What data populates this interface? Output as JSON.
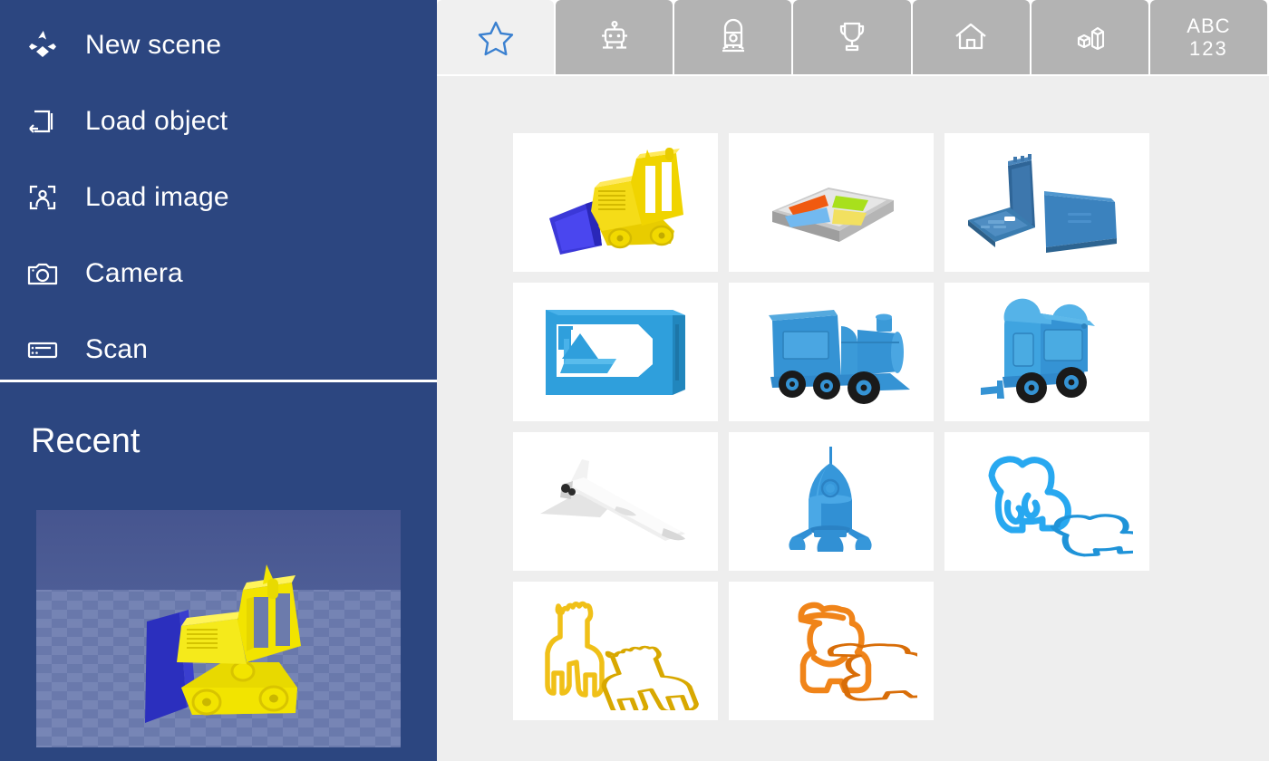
{
  "app": {
    "accent_blue": "#2c4680",
    "tab_inactive": "#b3b3b3",
    "tab_active": "#f0f0f0",
    "canvas_bg": "#eeeeee",
    "star_blue": "#3a80d0"
  },
  "sidebar": {
    "items": [
      {
        "label": "New scene",
        "icon": "new-scene-icon"
      },
      {
        "label": "Load object",
        "icon": "load-object-icon"
      },
      {
        "label": "Load image",
        "icon": "load-image-icon"
      },
      {
        "label": "Camera",
        "icon": "camera-icon"
      },
      {
        "label": "Scan",
        "icon": "scan-icon"
      }
    ],
    "recent": {
      "title": "Recent",
      "thumbnail": {
        "name": "bulldozer-scene-thumbnail",
        "body_color": "#f2e000",
        "blade_color": "#2a2fc0",
        "floor_color": "#6878ab"
      }
    }
  },
  "tabs": [
    {
      "label": "",
      "icon": "star-icon",
      "selected": true
    },
    {
      "label": "",
      "icon": "robot-icon",
      "selected": false
    },
    {
      "label": "",
      "icon": "train-icon",
      "selected": false
    },
    {
      "label": "",
      "icon": "trophy-icon",
      "selected": false
    },
    {
      "label": "",
      "icon": "house-icon",
      "selected": false
    },
    {
      "label": "",
      "icon": "shapes-icon",
      "selected": false
    },
    {
      "label": "ABC 123",
      "icon": "text-icon",
      "selected": false,
      "line1": "ABC",
      "line2": "123"
    }
  ],
  "gallery": {
    "rows": [
      [
        {
          "name": "bulldozer",
          "icon": "bulldozer-model",
          "color": "#f0c400"
        },
        {
          "name": "logo-tray",
          "icon": "logo-tray-model",
          "color": "#cccccc"
        },
        {
          "name": "hinged-case",
          "icon": "hinged-case-model",
          "color": "#3e77b5"
        }
      ],
      [
        {
          "name": "ship-in-bottle",
          "icon": "ship-bottle-model",
          "color": "#2f9fdc"
        },
        {
          "name": "locomotive",
          "icon": "locomotive-model",
          "color": "#3593d4"
        },
        {
          "name": "train-wagon",
          "icon": "wagon-model",
          "color": "#3a9ada"
        }
      ],
      [
        {
          "name": "space-shuttle",
          "icon": "shuttle-model",
          "color": "#d8d8d8"
        },
        {
          "name": "rocket",
          "icon": "rocket-model",
          "color": "#2f8fd5"
        },
        {
          "name": "elephant-cutter",
          "icon": "elephant-model",
          "color": "#28a8f0"
        }
      ],
      [
        {
          "name": "giraffe-cutter",
          "icon": "giraffe-model",
          "color": "#f0c018"
        },
        {
          "name": "bear-cutter",
          "icon": "bear-model",
          "color": "#f08419"
        },
        {
          "name": "",
          "icon": "",
          "color": ""
        }
      ]
    ]
  }
}
